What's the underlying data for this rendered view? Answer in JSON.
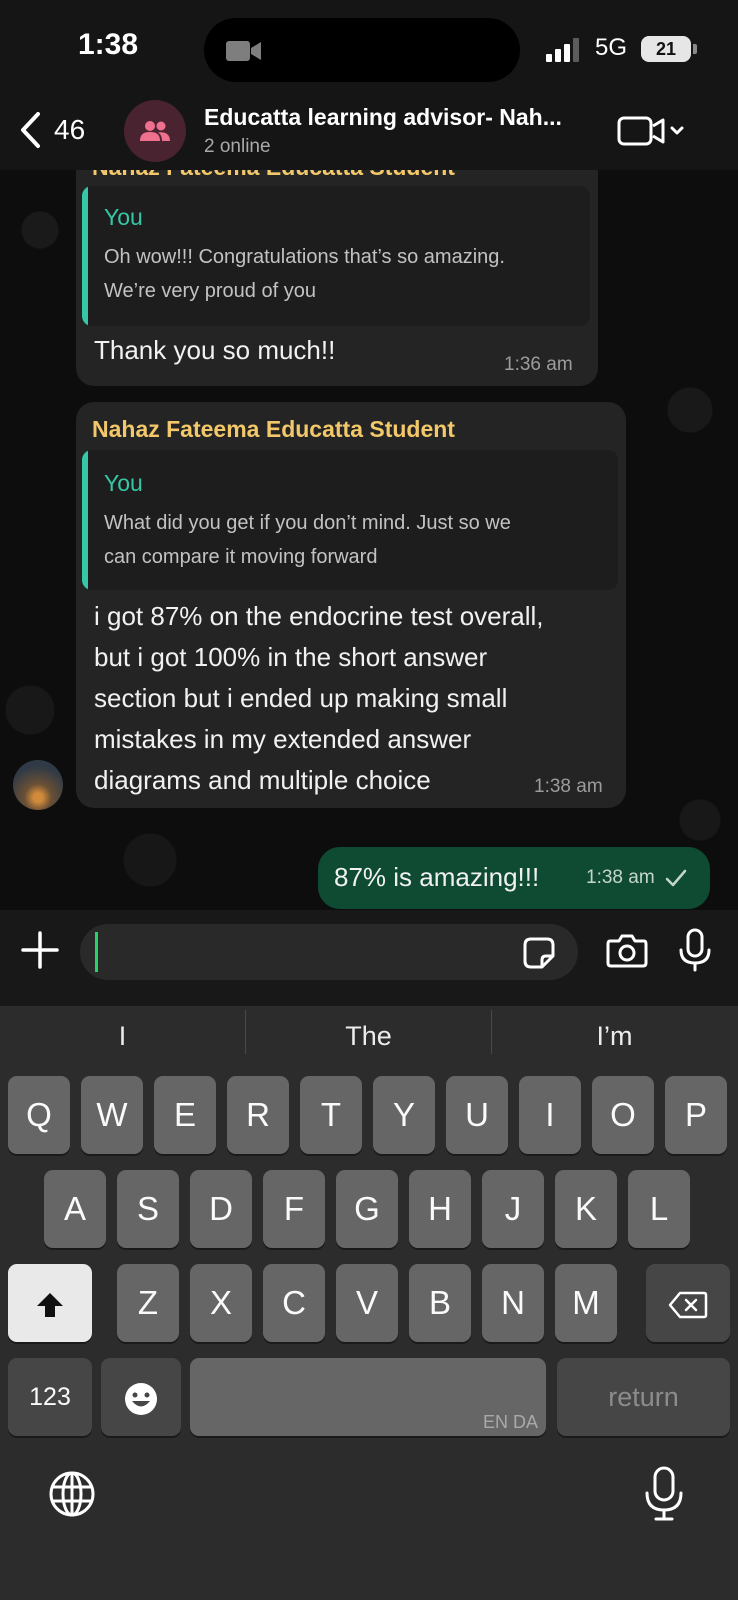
{
  "status_bar": {
    "time": "1:38",
    "network": "5G",
    "battery": "21"
  },
  "header": {
    "back_count": "46",
    "group_name": "Educatta learning advisor- Nah...",
    "group_status": "2 online"
  },
  "messages": [
    {
      "direction": "incoming",
      "sender": "Nahaz Fateema Educatta Student",
      "quote_author": "You",
      "quote_lines": [
        "Oh wow!!! Congratulations that’s so amazing.",
        "We’re very proud of you"
      ],
      "text_lines": [
        "Thank you so much!!"
      ],
      "time": "1:36 am"
    },
    {
      "direction": "incoming",
      "sender": "Nahaz Fateema Educatta Student",
      "quote_author": "You",
      "quote_lines": [
        "What did you get if you don’t mind. Just so we",
        "can compare it moving forward"
      ],
      "text_lines": [
        "i got 87% on the endocrine test overall,",
        "but i got 100% in the short answer",
        "section but i ended up making small",
        "mistakes in my extended answer",
        "diagrams and multiple choice"
      ],
      "time": "1:38 am"
    },
    {
      "direction": "outgoing",
      "text": "87% is amazing!!!",
      "time": "1:38 am",
      "status_icon": "single-check-icon"
    }
  ],
  "compose": {
    "text": ""
  },
  "keyboard": {
    "suggestions": [
      "I",
      "The",
      "I’m"
    ],
    "row1": [
      "Q",
      "W",
      "E",
      "R",
      "T",
      "Y",
      "U",
      "I",
      "O",
      "P"
    ],
    "row2": [
      "A",
      "S",
      "D",
      "F",
      "G",
      "H",
      "J",
      "K",
      "L"
    ],
    "row3": [
      "Z",
      "X",
      "C",
      "V",
      "B",
      "N",
      "M"
    ],
    "numbers_label": "123",
    "space_language": "EN DA",
    "return_label": "return"
  },
  "colors": {
    "accent_green": "#25d366",
    "outgoing_bubble": "#0f4b33",
    "sender_name": "#f3c86a",
    "quote_author": "#37c7a7"
  }
}
